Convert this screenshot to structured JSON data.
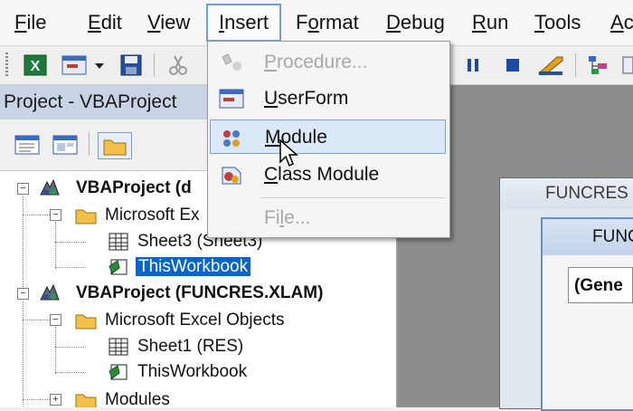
{
  "menubar": {
    "items": [
      {
        "pre": "",
        "ul": "F",
        "post": "ile"
      },
      {
        "pre": "",
        "ul": "E",
        "post": "dit"
      },
      {
        "pre": "",
        "ul": "V",
        "post": "iew"
      },
      {
        "pre": "",
        "ul": "I",
        "post": "nsert"
      },
      {
        "pre": "F",
        "ul": "o",
        "post": "rmat"
      },
      {
        "pre": "",
        "ul": "D",
        "post": "ebug"
      },
      {
        "pre": "",
        "ul": "R",
        "post": "un"
      },
      {
        "pre": "",
        "ul": "T",
        "post": "ools"
      },
      {
        "pre": "",
        "ul": "A",
        "post": "c"
      }
    ],
    "active_index": 3
  },
  "insert_menu": {
    "items": [
      {
        "pre": "",
        "ul": "P",
        "post": "rocedure...",
        "enabled": false,
        "icon": "procedure-icon"
      },
      {
        "pre": "",
        "ul": "U",
        "post": "serForm",
        "enabled": true,
        "icon": "userform-icon"
      },
      {
        "pre": "",
        "ul": "M",
        "post": "odule",
        "enabled": true,
        "icon": "module-icon",
        "highlighted": true
      },
      {
        "pre": "",
        "ul": "C",
        "post": "lass Module",
        "enabled": true,
        "icon": "class-module-icon"
      },
      {
        "pre": "Fi",
        "ul": "l",
        "post": "e...",
        "enabled": false
      }
    ]
  },
  "project_pane": {
    "title": "Project - VBAProject",
    "tree": [
      {
        "label": "VBAProject (d",
        "bold": true,
        "icon": "vba-project-icon"
      },
      {
        "label": "Microsoft Ex",
        "icon": "folder-icon"
      },
      {
        "label": "Sheet3 (Sheet3)",
        "icon": "sheet-icon"
      },
      {
        "label": "ThisWorkbook",
        "icon": "workbook-icon",
        "selected": true
      },
      {
        "label": "VBAProject (FUNCRES.XLAM)",
        "bold": true,
        "icon": "vba-project-icon"
      },
      {
        "label": "Microsoft Excel Objects",
        "icon": "folder-icon"
      },
      {
        "label": "Sheet1 (RES)",
        "icon": "sheet-icon"
      },
      {
        "label": "ThisWorkbook",
        "icon": "workbook-icon"
      },
      {
        "label": "Modules",
        "icon": "folder-icon"
      }
    ]
  },
  "code_windows": {
    "back_title": "FUNCRES",
    "front_title": "FUNC",
    "object_combo": "(Gene"
  },
  "colors": {
    "title_bar": "#c8d4e6",
    "selection": "#0a64d0",
    "menu_highlight": "#dbe8f7",
    "workspace": "#8c8c8c"
  }
}
